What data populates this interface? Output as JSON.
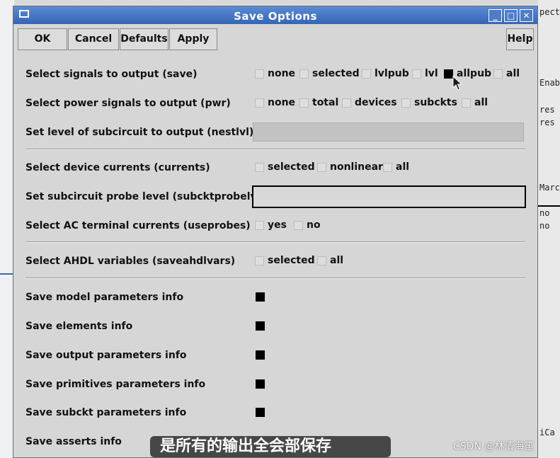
{
  "background_right_fragments": [
    "pect",
    "Enab",
    "res",
    "res",
    "Marc",
    "no",
    "no",
    "iCa"
  ],
  "window": {
    "title": "Save Options",
    "minimize_glyph": "_",
    "maximize_glyph": "□",
    "close_glyph": "✕"
  },
  "toolbar": {
    "ok": "OK",
    "cancel": "Cancel",
    "defaults": "Defaults",
    "apply": "Apply",
    "help": "Help"
  },
  "form": {
    "save": {
      "label": "Select signals to output (save)",
      "options": [
        {
          "label": "none",
          "checked": false
        },
        {
          "label": "selected",
          "checked": false
        },
        {
          "label": "lvlpub",
          "checked": false
        },
        {
          "label": "lvl",
          "checked": false
        },
        {
          "label": "allpub",
          "checked": true
        },
        {
          "label": "all",
          "checked": false
        }
      ]
    },
    "pwr": {
      "label": "Select power signals to output (pwr)",
      "options": [
        {
          "label": "none",
          "checked": false
        },
        {
          "label": "total",
          "checked": false
        },
        {
          "label": "devices",
          "checked": false
        },
        {
          "label": "subckts",
          "checked": false
        },
        {
          "label": "all",
          "checked": false
        }
      ]
    },
    "nestlvl": {
      "label": "Set level of subcircuit to output (nestlvl)",
      "value": ""
    },
    "currents": {
      "label": "Select device currents (currents)",
      "options": [
        {
          "label": "selected",
          "checked": false
        },
        {
          "label": "nonlinear",
          "checked": false
        },
        {
          "label": "all",
          "checked": false
        }
      ]
    },
    "subcktprobelvl": {
      "label": "Set subcircuit probe level (subcktprobelvl)",
      "value": ""
    },
    "useprobes": {
      "label": "Select AC terminal currents (useprobes)",
      "options": [
        {
          "label": "yes",
          "checked": false
        },
        {
          "label": "no",
          "checked": false
        }
      ]
    },
    "saveahdlvars": {
      "label": "Select AHDL variables (saveahdlvars)",
      "options": [
        {
          "label": "selected",
          "checked": false
        },
        {
          "label": "all",
          "checked": false
        }
      ]
    },
    "info": [
      {
        "label": "Save model parameters info",
        "checked": true
      },
      {
        "label": "Save elements info",
        "checked": true
      },
      {
        "label": "Save output parameters info",
        "checked": true
      },
      {
        "label": "Save primitives parameters info",
        "checked": true
      },
      {
        "label": "Save subckt parameters info",
        "checked": true
      },
      {
        "label": "Save asserts info",
        "checked": false
      }
    ]
  },
  "overlay": {
    "subtitle": "是所有的输出全会部保存",
    "watermark": "CSDN @林清海笙"
  }
}
